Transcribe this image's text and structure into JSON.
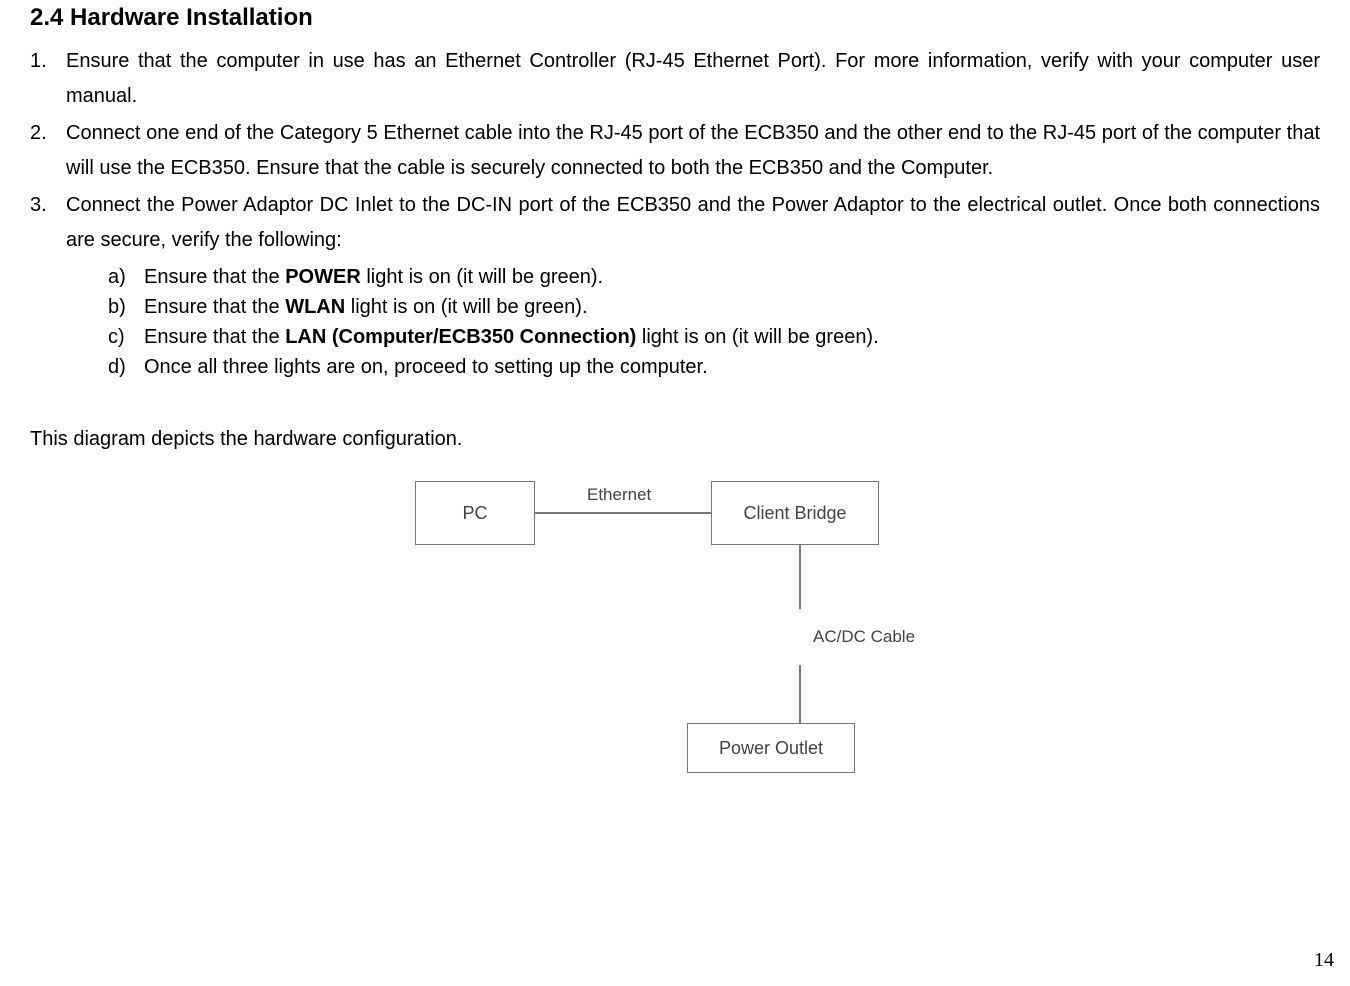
{
  "heading": "2.4   Hardware Installation",
  "steps": [
    "Ensure that the computer in use has an Ethernet Controller (RJ-45 Ethernet Port). For more information, verify with your computer user manual.",
    "Connect one end of the Category 5 Ethernet cable into the RJ-45 port of the ECB350 and the other end to the RJ-45 port of the computer that will use the ECB350. Ensure that the cable is securely connected to both the ECB350 and the Computer.",
    "Connect the Power Adaptor DC Inlet to the DC-IN port of the ECB350 and the Power Adaptor to the electrical outlet. Once both connections are secure, verify the following:"
  ],
  "substeps": {
    "a": {
      "pre": "Ensure that the ",
      "bold": "POWER",
      "post": " light is on (it will be green)."
    },
    "b": {
      "pre": "Ensure that the ",
      "bold": "WLAN",
      "post": " light is on (it will be green)."
    },
    "c": {
      "pre": "Ensure that the ",
      "bold": "LAN (Computer/ECB350 Connection)",
      "post": " light is on (it will be green)."
    },
    "d": {
      "full": "Once all three lights are on, proceed to setting up the computer."
    }
  },
  "caption": "This diagram depicts the hardware configuration.",
  "diagram": {
    "pc": "PC",
    "client_bridge": "Client Bridge",
    "power_outlet": "Power Outlet",
    "ethernet_label": "Ethernet",
    "acdc_label": "AC/DC Cable"
  },
  "page_number": "14"
}
